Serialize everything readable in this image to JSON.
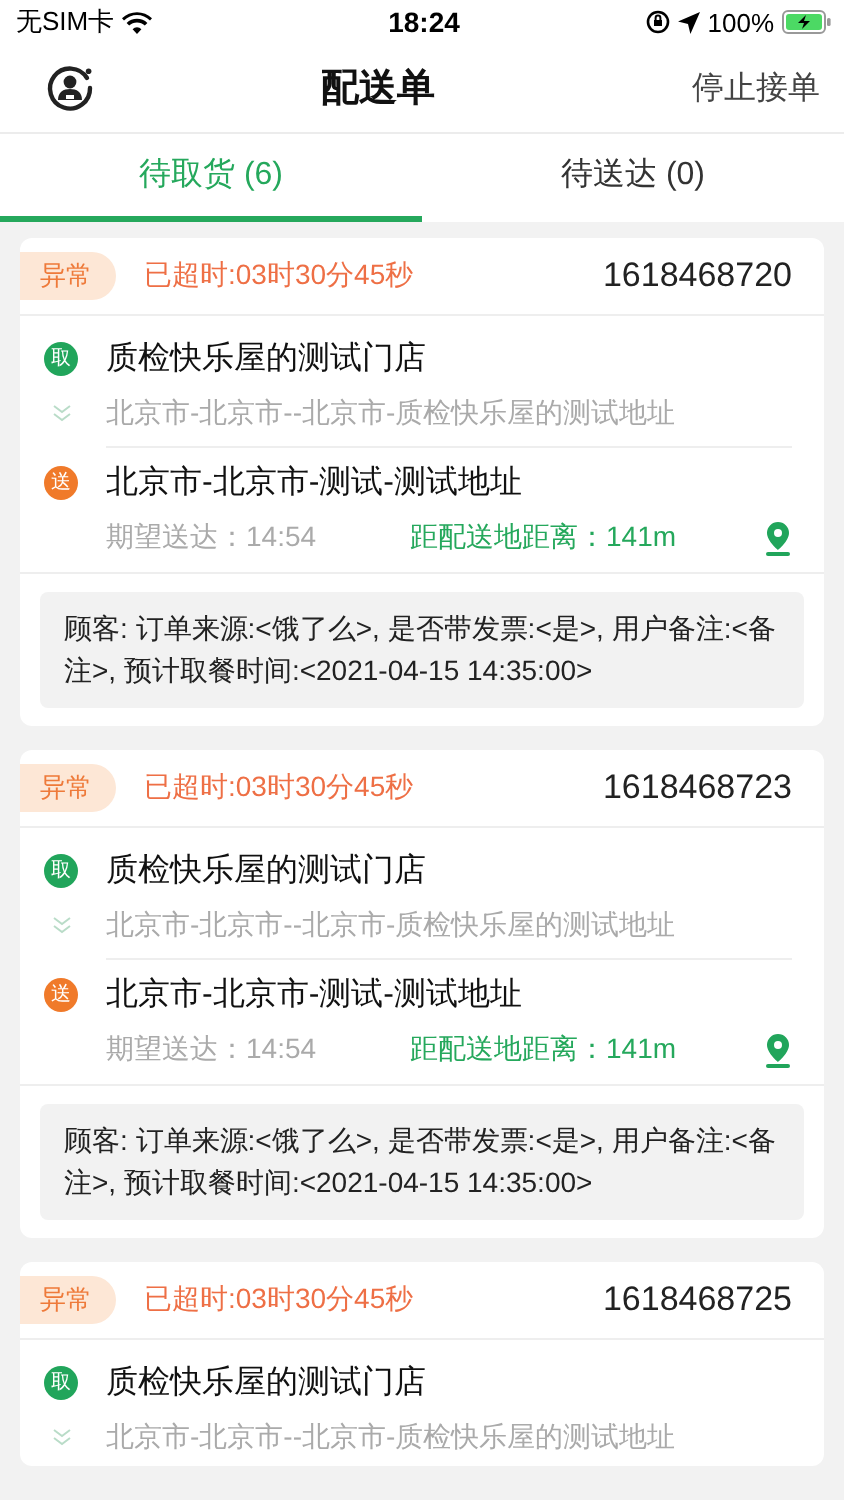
{
  "status_bar": {
    "carrier": "无SIM卡",
    "time": "18:24",
    "battery": "100%"
  },
  "nav": {
    "title": "配送单",
    "action": "停止接单"
  },
  "tabs": [
    {
      "label": "待取货 (6)",
      "selected": true
    },
    {
      "label": "待送达 (0)",
      "selected": false
    }
  ],
  "orders": [
    {
      "badge": "异常",
      "timeout": "已超时:03时30分45秒",
      "order_no": "1618468720",
      "pickup": {
        "marker": "取",
        "name": "质检快乐屋的测试门店",
        "address": "北京市-北京市--北京市-质检快乐屋的测试地址"
      },
      "delivery": {
        "marker": "送",
        "address": "北京市-北京市-测试-测试地址",
        "expected": "期望送达：14:54",
        "distance": "距配送地距离：141m"
      },
      "note": "顾客: 订单来源:<饿了么>, 是否带发票:<是>, 用户备注:<备注>, 预计取餐时间:<2021-04-15 14:35:00>"
    },
    {
      "badge": "异常",
      "timeout": "已超时:03时30分45秒",
      "order_no": "1618468723",
      "pickup": {
        "marker": "取",
        "name": "质检快乐屋的测试门店",
        "address": "北京市-北京市--北京市-质检快乐屋的测试地址"
      },
      "delivery": {
        "marker": "送",
        "address": "北京市-北京市-测试-测试地址",
        "expected": "期望送达：14:54",
        "distance": "距配送地距离：141m"
      },
      "note": "顾客: 订单来源:<饿了么>, 是否带发票:<是>, 用户备注:<备注>, 预计取餐时间:<2021-04-15 14:35:00>"
    },
    {
      "badge": "异常",
      "timeout": "已超时:03时30分45秒",
      "order_no": "1618468725",
      "pickup": {
        "marker": "取",
        "name": "质检快乐屋的测试门店",
        "address": "北京市-北京市--北京市-质检快乐屋的测试地址"
      }
    }
  ]
}
